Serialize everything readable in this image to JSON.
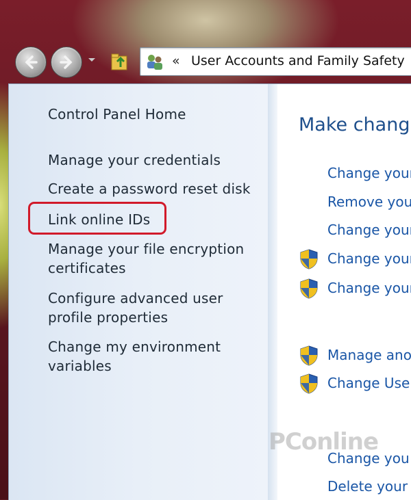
{
  "address_bar": {
    "chevron": "«",
    "path": "User Accounts and Family Safety"
  },
  "sidebar": {
    "home": "Control Panel Home",
    "links": [
      "Manage your credentials",
      "Create a password reset disk",
      "Link online IDs",
      "Manage your file encryption",
      "certificates",
      "Configure advanced user",
      "profile properties",
      "Change my environment",
      "variables"
    ],
    "highlighted_link": "Link online IDs"
  },
  "main": {
    "title": "Make change",
    "tasks": [
      {
        "label": "Change your",
        "shield": false
      },
      {
        "label": "Remove you",
        "shield": false
      },
      {
        "label": "Change your",
        "shield": false
      },
      {
        "label": "Change your",
        "shield": true
      },
      {
        "label": "Change your",
        "shield": true
      },
      {
        "label": "Manage ano",
        "shield": true
      },
      {
        "label": "Change User",
        "shield": true
      },
      {
        "label": "Change you",
        "shield": false
      },
      {
        "label": "Delete your",
        "shield": false
      }
    ]
  },
  "watermark": "PConline",
  "colors": {
    "highlight": "#d11a2a",
    "link": "#1a56a6",
    "title": "#1e4f8c"
  }
}
